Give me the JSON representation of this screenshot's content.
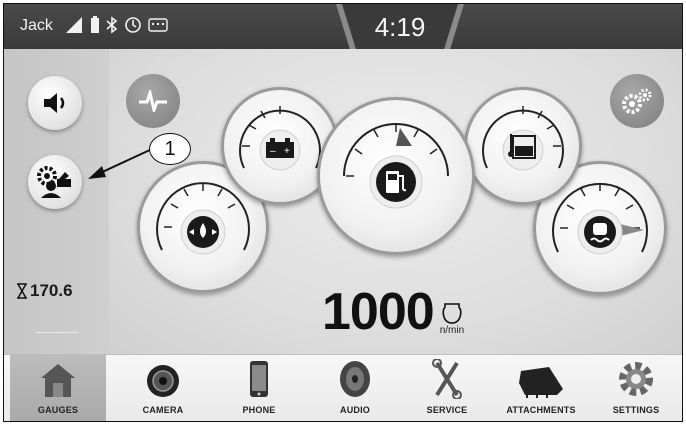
{
  "status_bar": {
    "user": "Jack",
    "time": "4:19",
    "icons": [
      "signal-icon",
      "battery-icon",
      "bluetooth-icon",
      "clock-icon",
      "keyboard-icon"
    ]
  },
  "side_panel": {
    "hours_value": "170.6",
    "hours_icon": "hourglass-icon",
    "fuel_level_fraction": 0.15
  },
  "callout": {
    "label": "1"
  },
  "gauges": [
    {
      "name": "oil-pressure",
      "icon": "oil-pressure-icon"
    },
    {
      "name": "battery",
      "icon": "battery-icon"
    },
    {
      "name": "fuel",
      "icon": "fuel-pump-icon"
    },
    {
      "name": "hydraulic-oil-temp",
      "icon": "hydraulic-temp-icon"
    },
    {
      "name": "coolant-temp",
      "icon": "coolant-temp-icon"
    }
  ],
  "engine_speed": {
    "value": "1000",
    "unit": "n/min"
  },
  "tabs": [
    {
      "label": "GAUGES",
      "icon": "home-icon",
      "active": true
    },
    {
      "label": "CAMERA",
      "icon": "camera-icon"
    },
    {
      "label": "PHONE",
      "icon": "phone-icon"
    },
    {
      "label": "AUDIO",
      "icon": "speaker-icon"
    },
    {
      "label": "SERVICE",
      "icon": "wrench-icon"
    },
    {
      "label": "ATTACHMENTS",
      "icon": "bucket-icon"
    },
    {
      "label": "SETTINGS",
      "icon": "gear-icon"
    }
  ],
  "colors": {
    "status_bar": "#3a3a3a",
    "accent_gray": "#7e7e7e"
  }
}
